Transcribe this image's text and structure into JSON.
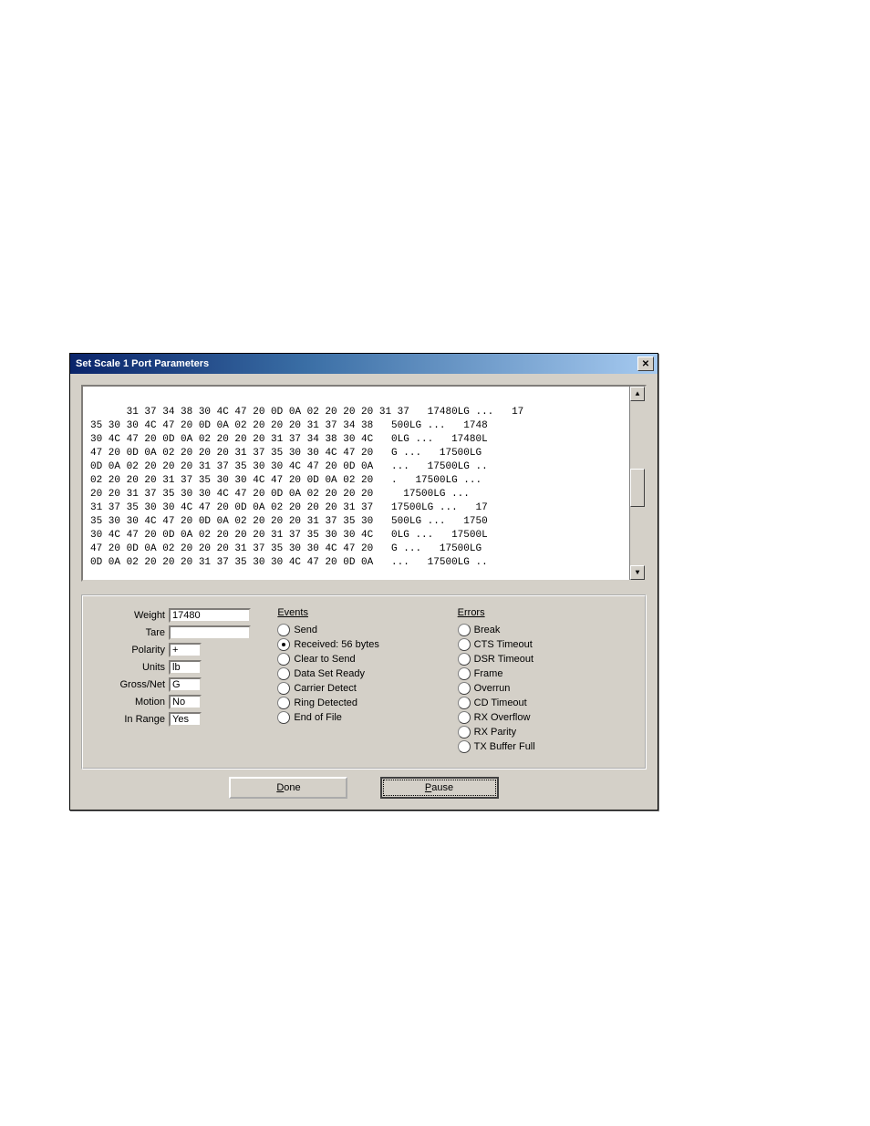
{
  "window": {
    "title": "Set Scale 1 Port Parameters"
  },
  "hexdump": "31 37 34 38 30 4C 47 20 0D 0A 02 20 20 20 31 37   17480LG ...   17\n35 30 30 4C 47 20 0D 0A 02 20 20 20 31 37 34 38   500LG ...   1748\n30 4C 47 20 0D 0A 02 20 20 20 31 37 34 38 30 4C   0LG ...   17480L\n47 20 0D 0A 02 20 20 20 31 37 35 30 30 4C 47 20   G ...   17500LG\n0D 0A 02 20 20 20 31 37 35 30 30 4C 47 20 0D 0A   ...   17500LG ..\n02 20 20 20 31 37 35 30 30 4C 47 20 0D 0A 02 20   .   17500LG ...\n20 20 31 37 35 30 30 4C 47 20 0D 0A 02 20 20 20     17500LG ...\n31 37 35 30 30 4C 47 20 0D 0A 02 20 20 20 31 37   17500LG ...   17\n35 30 30 4C 47 20 0D 0A 02 20 20 20 31 37 35 30   500LG ...   1750\n30 4C 47 20 0D 0A 02 20 20 20 31 37 35 30 30 4C   0LG ...   17500L\n47 20 0D 0A 02 20 20 20 31 37 35 30 30 4C 47 20   G ...   17500LG\n0D 0A 02 20 20 20 31 37 35 30 30 4C 47 20 0D 0A   ...   17500LG ..",
  "fields": {
    "weight_label": "Weight",
    "weight_value": "17480",
    "tare_label": "Tare",
    "tare_value": "",
    "polarity_label": "Polarity",
    "polarity_value": "+",
    "units_label": "Units",
    "units_value": "lb",
    "grossnet_label": "Gross/Net",
    "grossnet_value": "G",
    "motion_label": "Motion",
    "motion_value": "No",
    "inrange_label": "In Range",
    "inrange_value": "Yes"
  },
  "events": {
    "title": "Events",
    "items": [
      {
        "label": "Send",
        "selected": false
      },
      {
        "label": "Received: 56 bytes",
        "selected": true
      },
      {
        "label": "Clear to Send",
        "selected": false
      },
      {
        "label": "Data Set Ready",
        "selected": false
      },
      {
        "label": "Carrier Detect",
        "selected": false
      },
      {
        "label": "Ring Detected",
        "selected": false
      },
      {
        "label": "End of File",
        "selected": false
      }
    ]
  },
  "errors": {
    "title": "Errors",
    "items": [
      {
        "label": "Break"
      },
      {
        "label": "CTS Timeout"
      },
      {
        "label": "DSR Timeout"
      },
      {
        "label": "Frame"
      },
      {
        "label": "Overrun"
      },
      {
        "label": "CD Timeout"
      },
      {
        "label": "RX Overflow"
      },
      {
        "label": "RX Parity"
      },
      {
        "label": "TX Buffer Full"
      }
    ]
  },
  "buttons": {
    "done": "one",
    "done_u": "D",
    "pause": "ause",
    "pause_u": "P"
  }
}
